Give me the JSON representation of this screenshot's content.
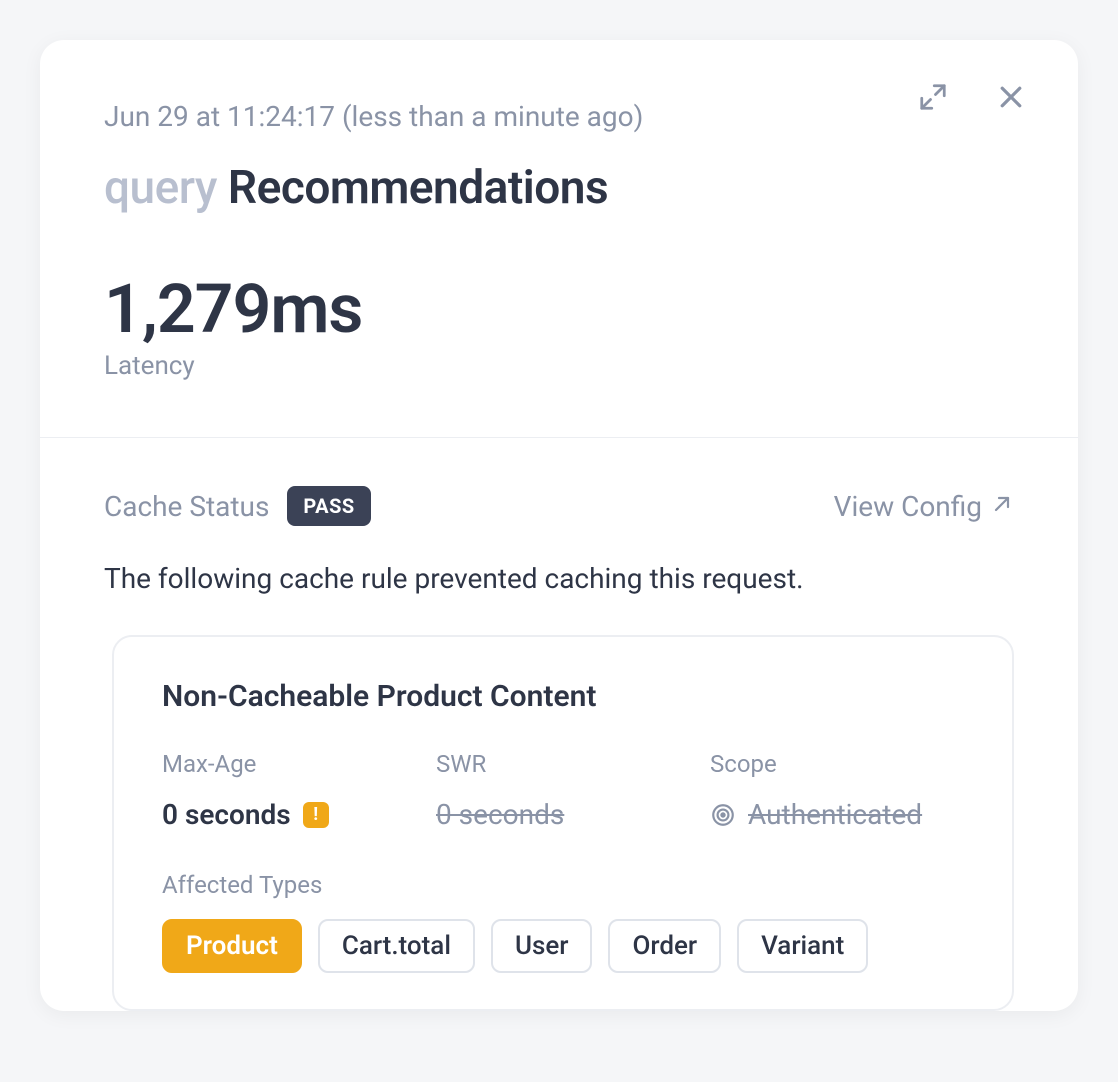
{
  "header": {
    "timestamp": "Jun 29 at 11:24:17 (less than a minute ago)",
    "title_prefix": "query",
    "title_name": "Recommendations",
    "latency_value": "1,279ms",
    "latency_label": "Latency"
  },
  "status": {
    "label": "Cache Status",
    "badge": "PASS",
    "view_config": "View Config"
  },
  "explain": "The following cache rule prevented caching this request.",
  "rule": {
    "title": "Non-Cacheable Product Content",
    "cols": {
      "maxage_label": "Max-Age",
      "maxage_value": "0 seconds",
      "swr_label": "SWR",
      "swr_value": "0 seconds",
      "scope_label": "Scope",
      "scope_value": "Authenticated"
    },
    "affected_label": "Affected Types",
    "tags": [
      {
        "label": "Product",
        "active": true
      },
      {
        "label": "Cart.total",
        "active": false
      },
      {
        "label": "User",
        "active": false
      },
      {
        "label": "Order",
        "active": false
      },
      {
        "label": "Variant",
        "active": false
      }
    ]
  },
  "icons": {
    "expand": "expand-icon",
    "close": "close-icon",
    "external": "external-link-icon",
    "warning": "!",
    "target": "target-icon"
  }
}
